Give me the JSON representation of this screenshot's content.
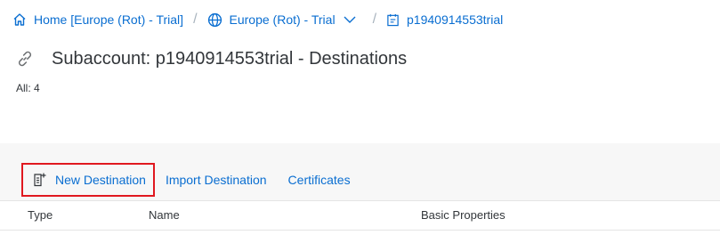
{
  "breadcrumb": {
    "home": "Home [Europe (Rot) - Trial]",
    "region": "Europe (Rot) - Trial",
    "subaccount": "p1940914553trial",
    "separator": "/"
  },
  "page": {
    "title": "Subaccount: p1940914553trial - Destinations",
    "count": "All: 4"
  },
  "toolbar": {
    "new_destination": "New Destination",
    "import_destination": "Import Destination",
    "certificates": "Certificates"
  },
  "table": {
    "columns": [
      "Type",
      "Name",
      "Basic Properties"
    ]
  },
  "colors": {
    "link": "#0a6ed1",
    "highlight_border": "#e0181f",
    "text": "#32363a"
  },
  "icons": [
    "home-icon",
    "globe-icon",
    "chevron-down-icon",
    "subaccount-icon",
    "link-icon",
    "new-document-icon"
  ]
}
